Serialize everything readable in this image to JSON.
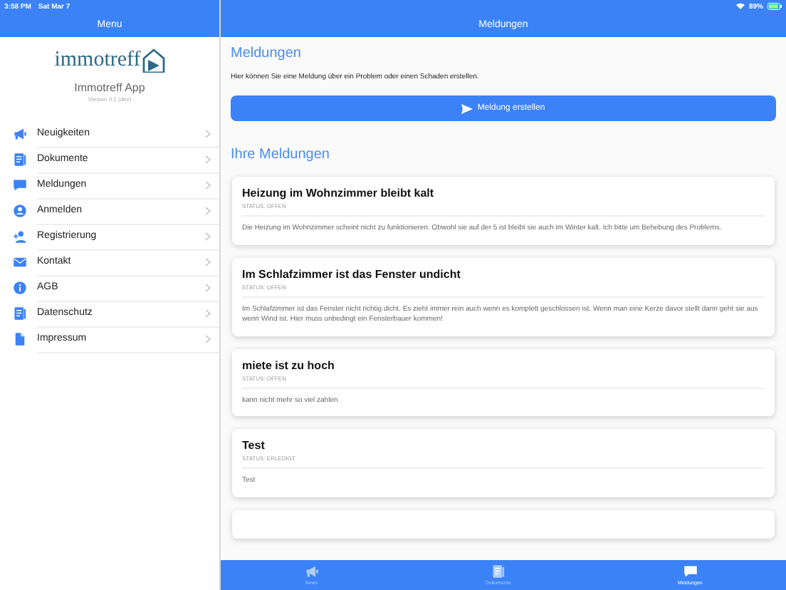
{
  "status_bar": {
    "time": "3:58 PM",
    "date": "Sat Mar 7",
    "battery": "89%"
  },
  "sidebar": {
    "title": "Menu",
    "logo_text": "immotreff",
    "app_name": "Immotreff App",
    "version": "Version 0.1 (dev)",
    "items": [
      {
        "label": "Neuigkeiten",
        "kind": "megaphone"
      },
      {
        "label": "Dokumente",
        "kind": "document"
      },
      {
        "label": "Meldungen",
        "kind": "chat"
      },
      {
        "label": "Anmelden",
        "kind": "account"
      },
      {
        "label": "Registrierung",
        "kind": "signup"
      },
      {
        "label": "Kontakt",
        "kind": "mail"
      },
      {
        "label": "AGB",
        "kind": "info"
      },
      {
        "label": "Datenschutz",
        "kind": "document"
      },
      {
        "label": "Impressum",
        "kind": "file"
      }
    ]
  },
  "main": {
    "title": "Meldungen",
    "heading": "Meldungen",
    "intro": "Hier können Sie eine Meldung über ein Problem oder einen Schaden erstellen.",
    "create_button": "Meldung erstellen",
    "list_heading": "Ihre Meldungen",
    "reports": [
      {
        "title": "Heizung im Wohnzimmer bleibt kalt",
        "status": "STATUS: OFFEN",
        "text": "Die Heizung im Wohnzimmer scheint nicht zu funktionieren. Obwohl sie auf der 5 ist bleibt sie auch im Winter kalt. Ich bitte um Behebung des Problems."
      },
      {
        "title": "Im Schlafzimmer ist das Fenster undicht",
        "status": "STATUS: OFFEN",
        "text": "Im Schlafzimmer ist das Fenster nicht richtig dicht. Es zieht immer rein auch wenn es komplett geschlossen ist. Wenn man eine Kerze davor stellt dann geht sie aus wenn Wind ist. Hier muss unbedingt ein Fensterbauer kommen!"
      },
      {
        "title": "miete ist zu hoch",
        "status": "STATUS: OFFEN",
        "text": "kann nicht mehr so viel zahlen"
      },
      {
        "title": "Test",
        "status": "STATUS: ERLEDIGT",
        "text": "Test"
      }
    ]
  },
  "tab_bar": [
    {
      "label": "News",
      "kind": "megaphone",
      "selected": false
    },
    {
      "label": "Dokumente",
      "kind": "document",
      "selected": false
    },
    {
      "label": "Meldungen",
      "kind": "chat",
      "selected": true
    }
  ]
}
